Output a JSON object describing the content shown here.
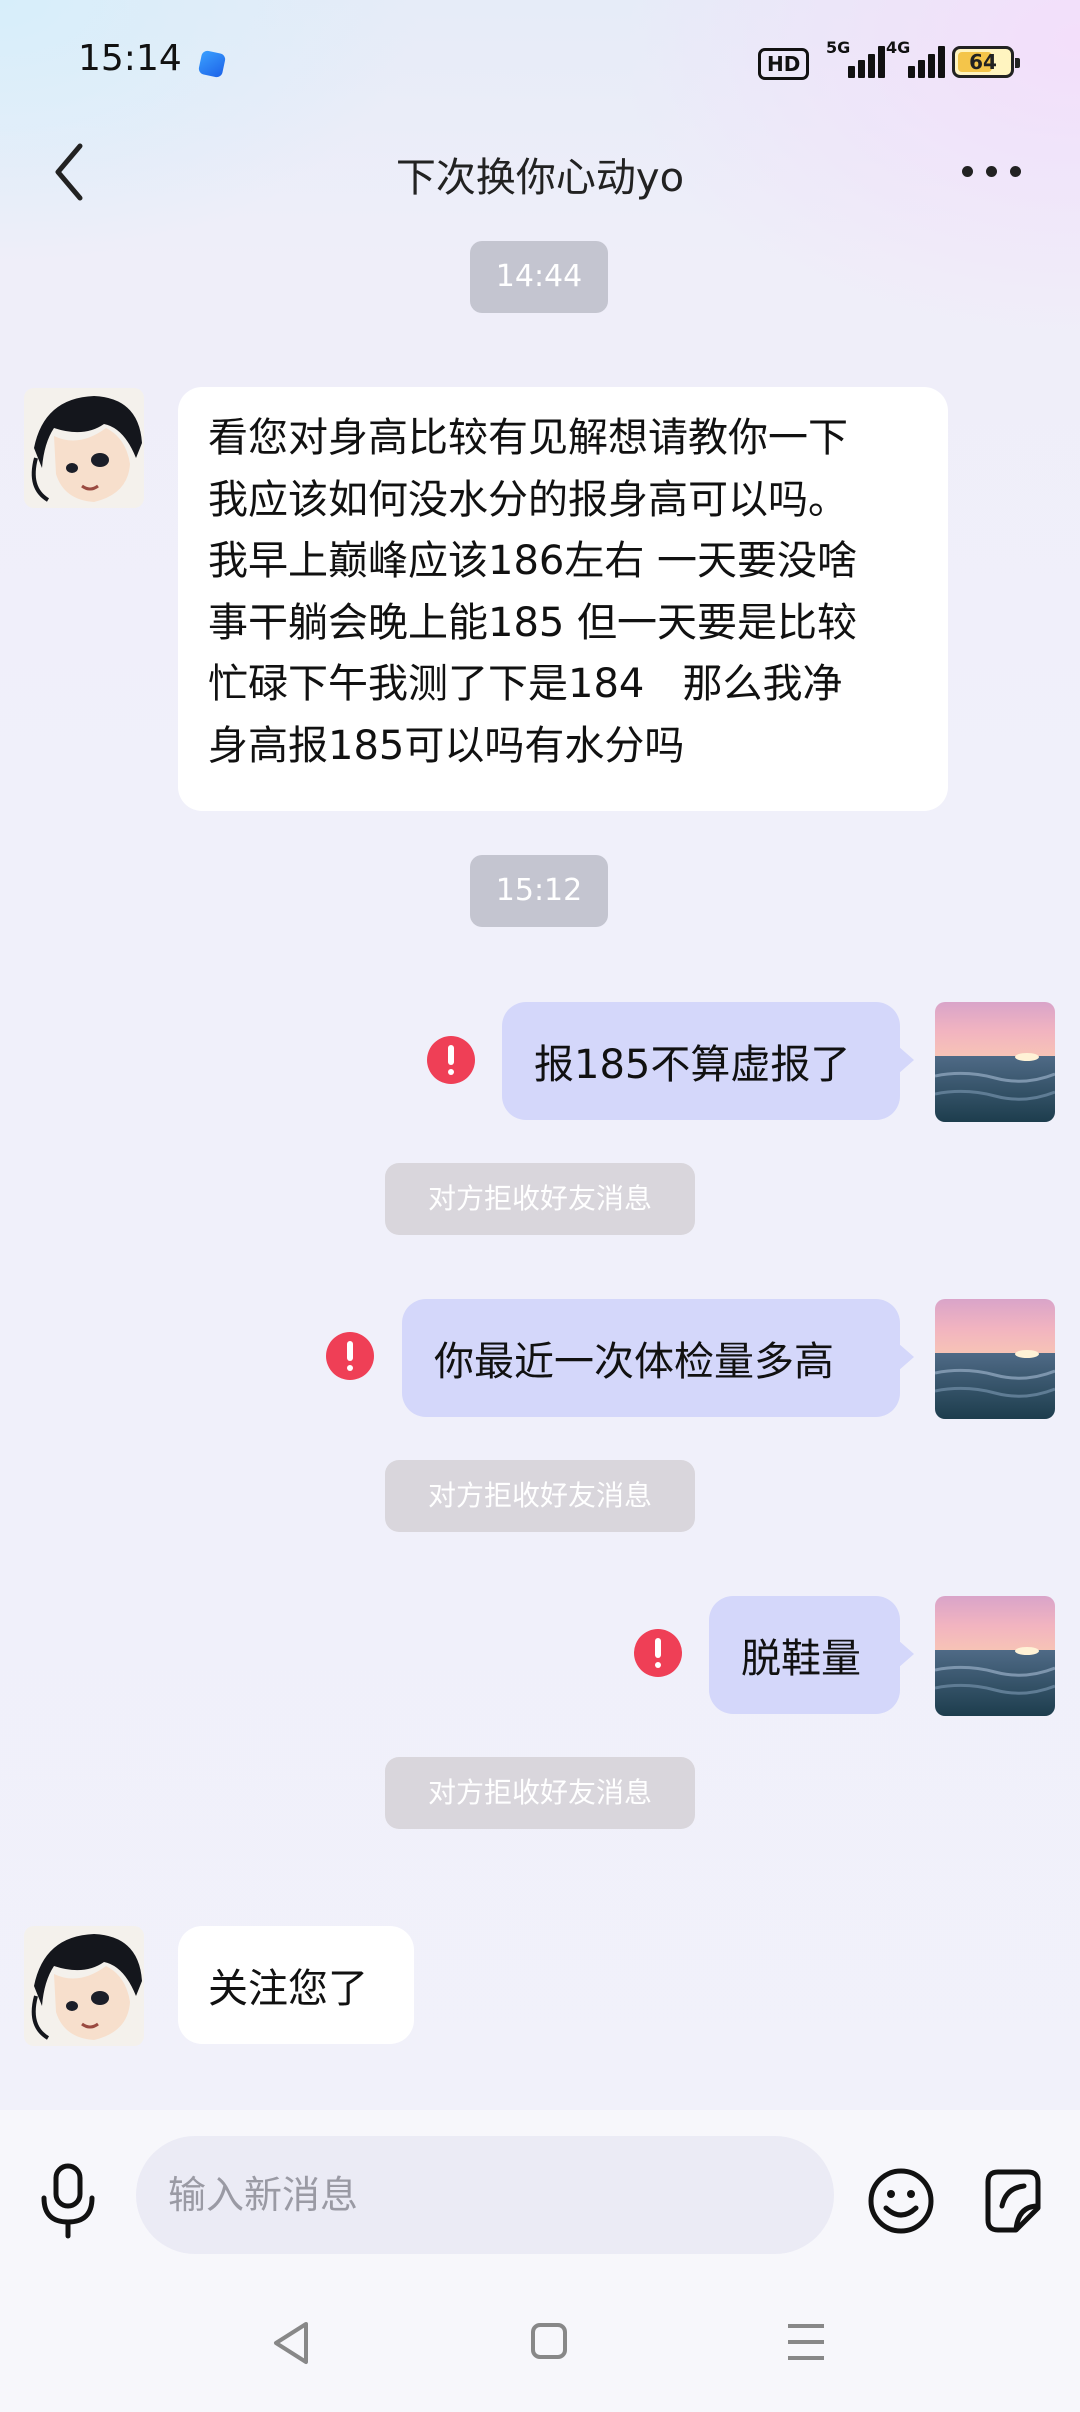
{
  "status_bar": {
    "time": "15:14",
    "hd_label": "HD",
    "signal1_label": "5G",
    "signal2_label": "4G",
    "battery": "64"
  },
  "header": {
    "title": "下次换你心动yo",
    "back_icon": "chevron-left-icon",
    "more_icon": "more-horizontal-icon"
  },
  "messages": {
    "time1": "14:44",
    "incoming1": {
      "lines": [
        "看您对身高比较有见解想请教你一下",
        "我应该如何没水分的报身高可以吗。",
        "我早上巅峰应该186左右 一天要没啥",
        "事干躺会晚上能185 但一天要是比较",
        "忙碌下午我测了下是184   那么我净",
        "身高报185可以吗有水分吗"
      ]
    },
    "time2": "15:12",
    "outgoing1": "报185不算虚报了",
    "system1": "对方拒收好友消息",
    "outgoing2": "你最近一次体检量多高",
    "system2": "对方拒收好友消息",
    "outgoing3": "脱鞋量",
    "system3": "对方拒收好友消息",
    "incoming2": "关注您了"
  },
  "input": {
    "placeholder": "输入新消息",
    "mic_icon": "microphone-icon",
    "emoji_icon": "emoji-icon",
    "sticker_icon": "sticker-icon"
  },
  "colors": {
    "outgoing_bubble": "#d4d7fa",
    "incoming_bubble": "#ffffff",
    "error": "#ef3f56"
  }
}
